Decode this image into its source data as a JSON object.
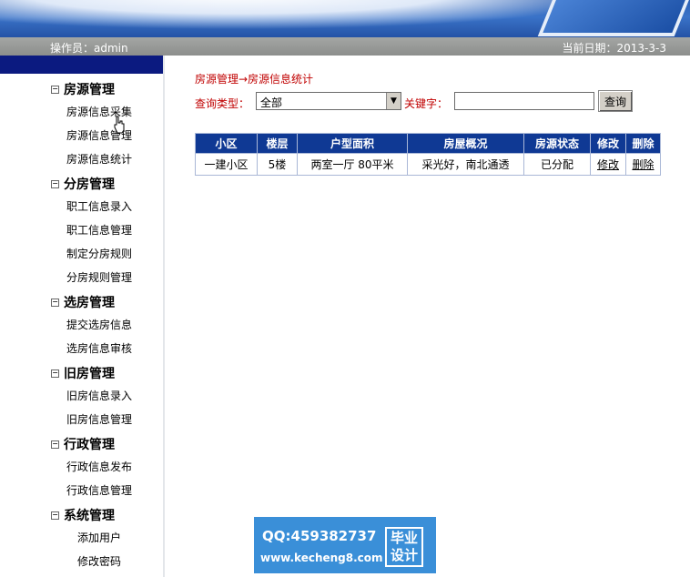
{
  "header": {
    "operator_label": "操作员：admin",
    "date_label": "当前日期：2013-3-3"
  },
  "sidebar": {
    "groups": [
      {
        "title": "房源管理",
        "items": [
          "房源信息采集",
          "房源信息管理",
          "房源信息统计"
        ]
      },
      {
        "title": "分房管理",
        "items": [
          "职工信息录入",
          "职工信息管理",
          "制定分房规则",
          "分房规则管理"
        ]
      },
      {
        "title": "选房管理",
        "items": [
          "提交选房信息",
          "选房信息审核"
        ]
      },
      {
        "title": "旧房管理",
        "items": [
          "旧房信息录入",
          "旧房信息管理"
        ]
      },
      {
        "title": "行政管理",
        "items": [
          "行政信息发布",
          "行政信息管理"
        ]
      },
      {
        "title": "系统管理",
        "items": [
          "添加用户",
          "修改密码"
        ]
      }
    ]
  },
  "main": {
    "breadcrumb": "房源管理→房源信息统计",
    "query_type_label": "查询类型：",
    "query_type_value": "全部",
    "keyword_label": "关键字：",
    "keyword_value": "",
    "query_button": "查询",
    "table": {
      "headers": [
        "小区",
        "楼层",
        "户型面积",
        "房屋概况",
        "房源状态",
        "修改",
        "删除"
      ],
      "rows": [
        [
          "一建小区",
          "5楼",
          "两室一厅  80平米",
          "采光好，南北通透",
          "已分配",
          "修改",
          "删除"
        ]
      ]
    }
  },
  "watermark": {
    "qq": "QQ:459382737",
    "site": "www.kecheng8.com",
    "badge": "毕业设计"
  },
  "colors": {
    "header_blue": "#0f3994",
    "nav_top": "#0b1a80",
    "label_red": "#c00000",
    "statusbar_gray": "#9a9c9a"
  }
}
